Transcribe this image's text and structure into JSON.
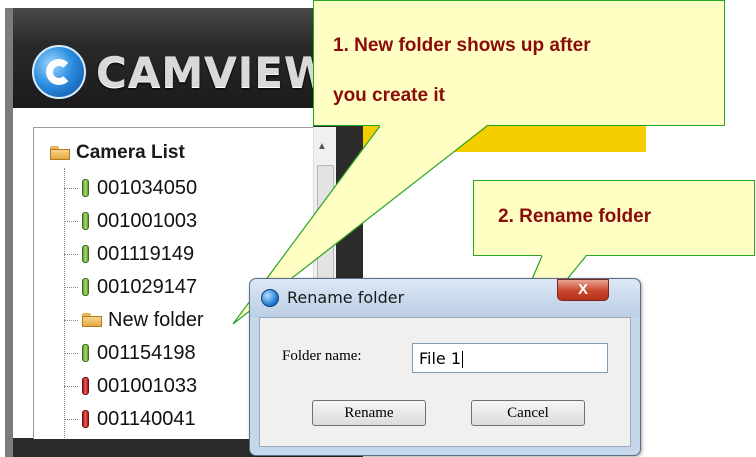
{
  "app": {
    "logo_text": "CAMVIEW"
  },
  "camera_list": {
    "root_label": "Camera List",
    "items": [
      {
        "label": "001034050",
        "type": "camera",
        "status": "online"
      },
      {
        "label": "001001003",
        "type": "camera",
        "status": "online"
      },
      {
        "label": "001119149",
        "type": "camera",
        "status": "online"
      },
      {
        "label": "001029147",
        "type": "camera",
        "status": "online"
      },
      {
        "label": "New folder",
        "type": "folder"
      },
      {
        "label": "001154198",
        "type": "camera",
        "status": "online"
      },
      {
        "label": "001001033",
        "type": "camera",
        "status": "offline"
      },
      {
        "label": "001140041",
        "type": "camera",
        "status": "offline"
      }
    ]
  },
  "callouts": {
    "first_line1": "1. New folder shows up after",
    "first_line2": "you create it",
    "second": "2. Rename folder"
  },
  "dialog": {
    "title": "Rename folder",
    "close_label": "X",
    "field_label": "Folder name:",
    "field_value": "File 1",
    "rename_button": "Rename",
    "cancel_button": "Cancel"
  },
  "colors": {
    "callout_fill": "#ffffc4",
    "callout_border": "#27a327",
    "callout_text": "#8b0b0b",
    "accent_yellow": "#f5ce00",
    "camera_online": "#8cc152",
    "camera_offline": "#d01818"
  }
}
